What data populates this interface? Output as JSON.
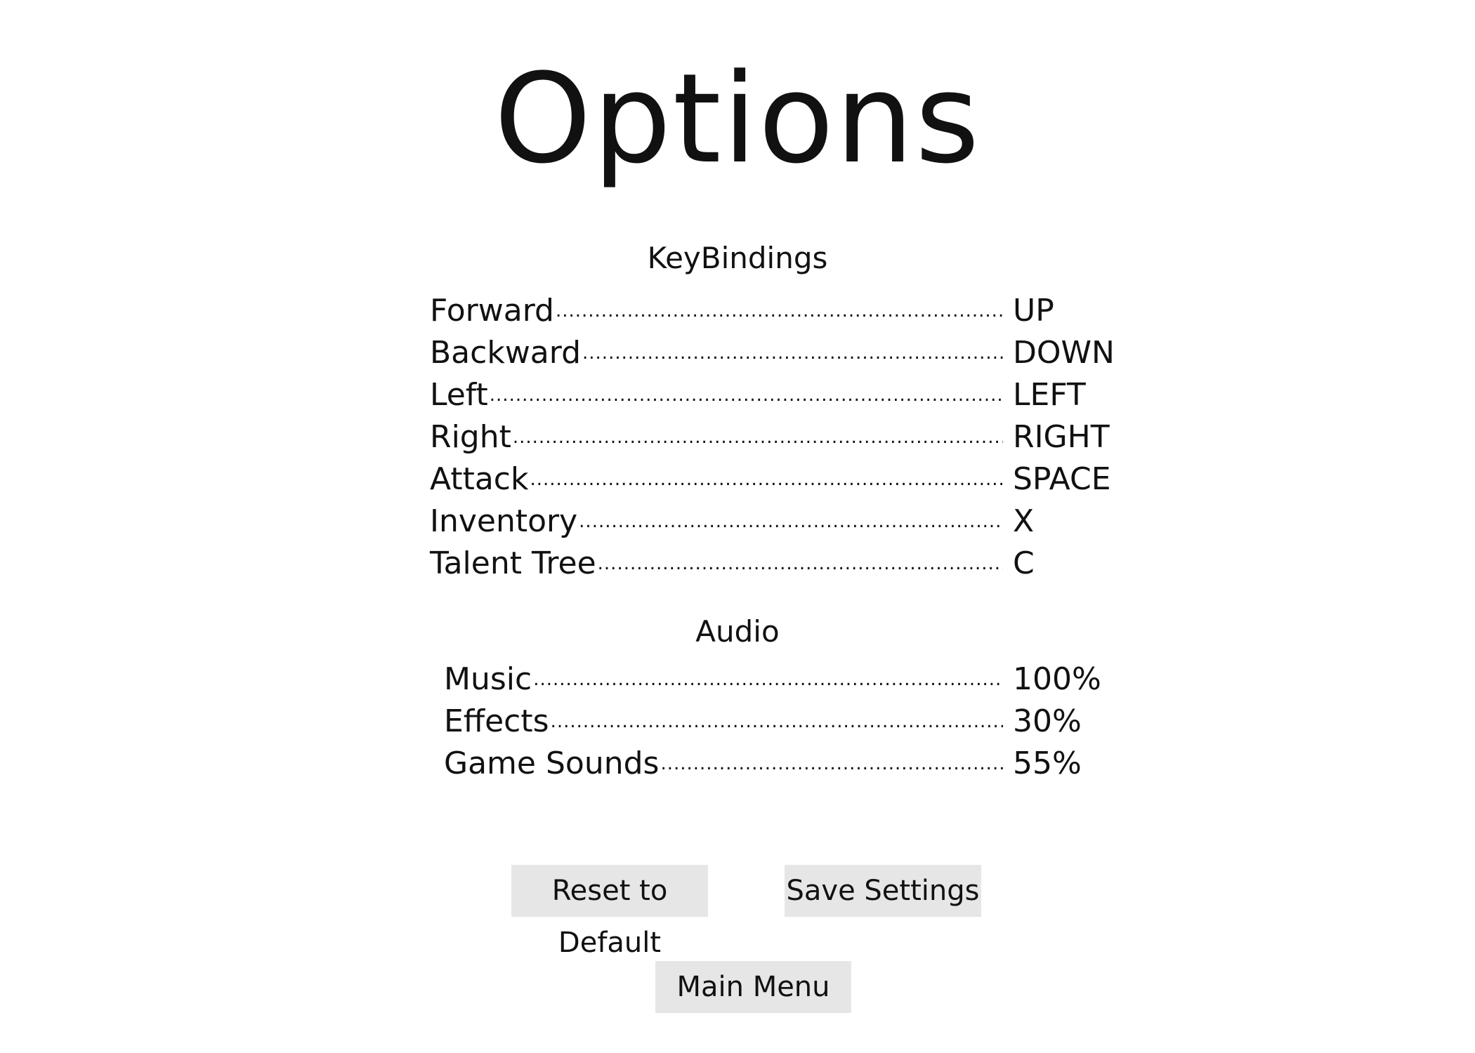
{
  "screen": {
    "title": "Options"
  },
  "keybindings": {
    "heading": "KeyBindings",
    "rows": [
      {
        "label": "Forward",
        "value": "UP"
      },
      {
        "label": "Backward",
        "value": "DOWN"
      },
      {
        "label": "Left",
        "value": "LEFT"
      },
      {
        "label": "Right",
        "value": "RIGHT"
      },
      {
        "label": "Attack",
        "value": "SPACE"
      },
      {
        "label": "Inventory",
        "value": "X"
      },
      {
        "label": "Talent Tree",
        "value": "C"
      }
    ]
  },
  "audio": {
    "heading": "Audio",
    "rows": [
      {
        "label": "Music",
        "value": "100%"
      },
      {
        "label": "Effects",
        "value": "30%"
      },
      {
        "label": "Game Sounds",
        "value": "55%"
      }
    ]
  },
  "buttons": {
    "reset_label": "Reset to Default",
    "save_label": "Save Settings",
    "main_menu_label": "Main Menu"
  },
  "colors": {
    "background": "#ffffff",
    "text": "#111111",
    "button_background": "#e6e6e6"
  }
}
